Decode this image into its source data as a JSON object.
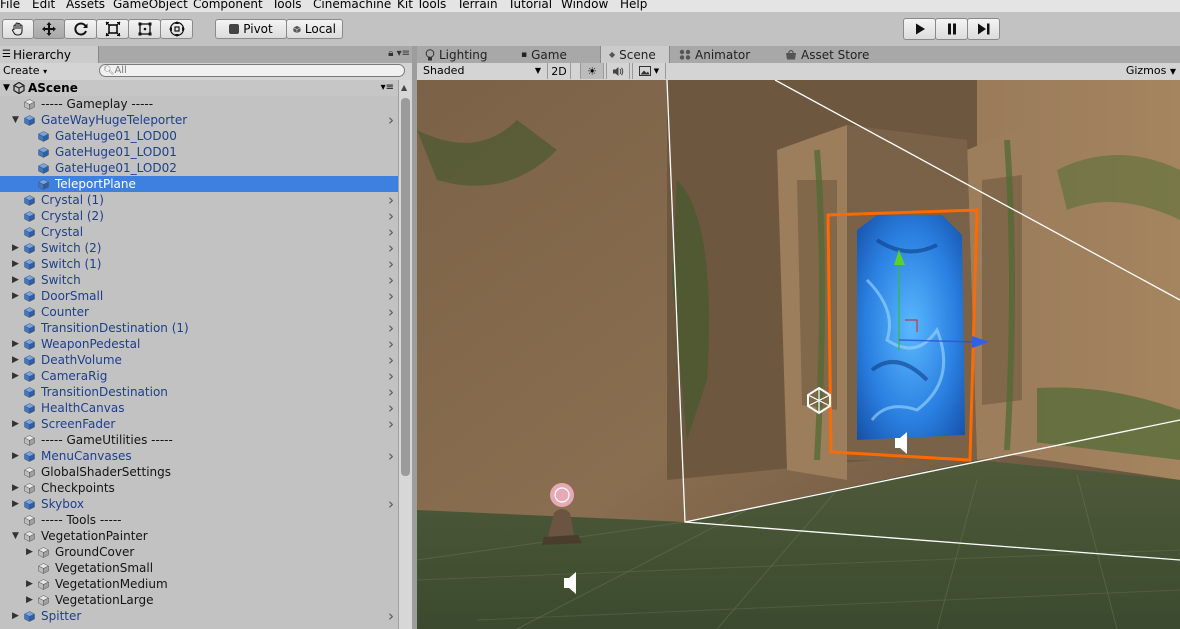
{
  "menu": {
    "items": [
      "File",
      "Edit",
      "Assets",
      "GameObject",
      "Component",
      "Tools",
      "Cinemachine",
      "Kit Tools",
      "Terrain",
      "Tutorial",
      "Window",
      "Help"
    ]
  },
  "toolbar": {
    "pivot_label": "Pivot",
    "local_label": "Local"
  },
  "hierarchy": {
    "tab_label": "Hierarchy",
    "create_label": "Create",
    "search_placeholder": "All",
    "scene_name": "AScene",
    "rows": [
      {
        "label": "----- Gameplay -----",
        "depth": 0,
        "arrow": "",
        "color": "black",
        "child": false
      },
      {
        "label": "GateWayHugeTeleporter",
        "depth": 0,
        "arrow": "down",
        "color": "blue",
        "child": true
      },
      {
        "label": "GateHuge01_LOD00",
        "depth": 1,
        "arrow": "",
        "color": "blue",
        "child": false
      },
      {
        "label": "GateHuge01_LOD01",
        "depth": 1,
        "arrow": "",
        "color": "blue",
        "child": false
      },
      {
        "label": "GateHuge01_LOD02",
        "depth": 1,
        "arrow": "",
        "color": "blue",
        "child": false
      },
      {
        "label": "TeleportPlane",
        "depth": 1,
        "arrow": "",
        "color": "blue",
        "child": false,
        "selected": true
      },
      {
        "label": "Crystal (1)",
        "depth": 0,
        "arrow": "",
        "color": "blue",
        "child": true
      },
      {
        "label": "Crystal (2)",
        "depth": 0,
        "arrow": "",
        "color": "blue",
        "child": true
      },
      {
        "label": "Crystal",
        "depth": 0,
        "arrow": "",
        "color": "blue",
        "child": true
      },
      {
        "label": "Switch (2)",
        "depth": 0,
        "arrow": "right",
        "color": "blue",
        "child": true
      },
      {
        "label": "Switch (1)",
        "depth": 0,
        "arrow": "right",
        "color": "blue",
        "child": true
      },
      {
        "label": "Switch",
        "depth": 0,
        "arrow": "right",
        "color": "blue",
        "child": true
      },
      {
        "label": "DoorSmall",
        "depth": 0,
        "arrow": "right",
        "color": "blue",
        "child": true
      },
      {
        "label": "Counter",
        "depth": 0,
        "arrow": "",
        "color": "blue",
        "child": true
      },
      {
        "label": "TransitionDestination (1)",
        "depth": 0,
        "arrow": "",
        "color": "blue",
        "child": true
      },
      {
        "label": "WeaponPedestal",
        "depth": 0,
        "arrow": "right",
        "color": "blue",
        "child": true
      },
      {
        "label": "DeathVolume",
        "depth": 0,
        "arrow": "right",
        "color": "blue",
        "child": true
      },
      {
        "label": "CameraRig",
        "depth": 0,
        "arrow": "right",
        "color": "blue",
        "child": true
      },
      {
        "label": "TransitionDestination",
        "depth": 0,
        "arrow": "",
        "color": "blue",
        "child": true
      },
      {
        "label": "HealthCanvas",
        "depth": 0,
        "arrow": "",
        "color": "blue",
        "child": true
      },
      {
        "label": "ScreenFader",
        "depth": 0,
        "arrow": "right",
        "color": "blue",
        "child": true
      },
      {
        "label": "----- GameUtilities -----",
        "depth": 0,
        "arrow": "",
        "color": "black",
        "child": false
      },
      {
        "label": "MenuCanvases",
        "depth": 0,
        "arrow": "right",
        "color": "blue",
        "child": true
      },
      {
        "label": "GlobalShaderSettings",
        "depth": 0,
        "arrow": "",
        "color": "black",
        "child": false
      },
      {
        "label": "Checkpoints",
        "depth": 0,
        "arrow": "right",
        "color": "black",
        "child": false
      },
      {
        "label": "Skybox",
        "depth": 0,
        "arrow": "right",
        "color": "blue",
        "child": true
      },
      {
        "label": "----- Tools -----",
        "depth": 0,
        "arrow": "",
        "color": "black",
        "child": false
      },
      {
        "label": "VegetationPainter",
        "depth": 0,
        "arrow": "down",
        "color": "black",
        "child": false
      },
      {
        "label": "GroundCover",
        "depth": 1,
        "arrow": "right",
        "color": "black",
        "child": false
      },
      {
        "label": "VegetationSmall",
        "depth": 1,
        "arrow": "",
        "color": "black",
        "child": false
      },
      {
        "label": "VegetationMedium",
        "depth": 1,
        "arrow": "right",
        "color": "black",
        "child": false
      },
      {
        "label": "VegetationLarge",
        "depth": 1,
        "arrow": "right",
        "color": "black",
        "child": false
      },
      {
        "label": "Spitter",
        "depth": 0,
        "arrow": "right",
        "color": "blue",
        "child": true
      }
    ]
  },
  "scene": {
    "tabs": [
      {
        "label": "Lighting",
        "icon": "lightbulb-icon"
      },
      {
        "label": "Game",
        "icon": "game-icon"
      },
      {
        "label": "Scene",
        "icon": "scene-icon"
      },
      {
        "label": "Animator",
        "icon": "animator-icon"
      },
      {
        "label": "Asset Store",
        "icon": "store-icon"
      }
    ],
    "shading_mode": "Shaded",
    "mode_2d_label": "2D",
    "gizmos_label": "Gizmos"
  },
  "colors": {
    "selection": "#3d80df",
    "prefab_text": "#1d3f8c",
    "portal": "#3aa0ff",
    "selection_outline": "#ff6a00"
  }
}
